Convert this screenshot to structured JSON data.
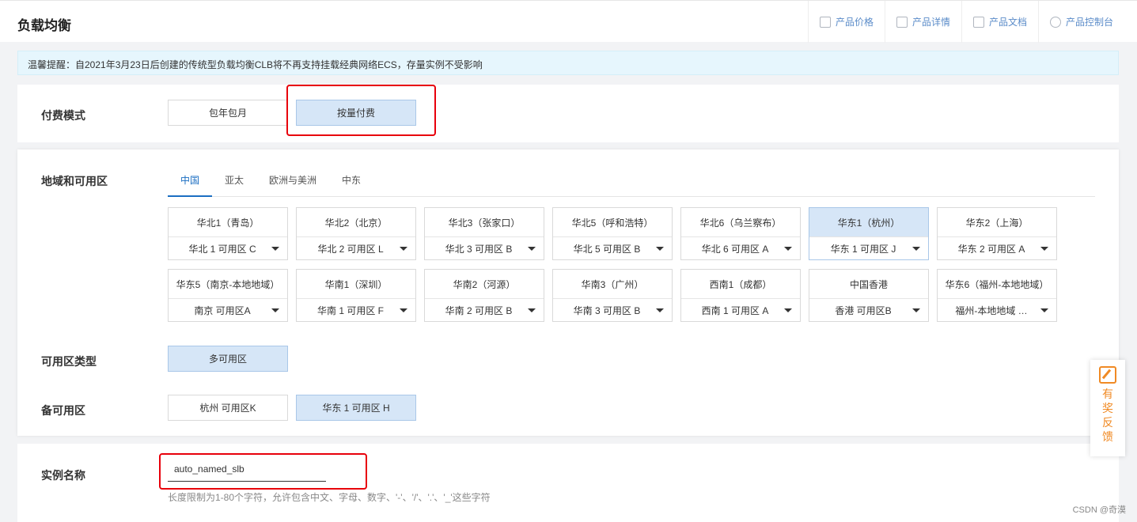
{
  "header": {
    "title": "负载均衡",
    "links": [
      {
        "label": "产品价格",
        "icon": "document-icon"
      },
      {
        "label": "产品详情",
        "icon": "list-icon"
      },
      {
        "label": "产品文档",
        "icon": "doc-icon"
      },
      {
        "label": "产品控制台",
        "icon": "gear-icon"
      }
    ]
  },
  "notice": "温馨提醒：自2021年3月23日后创建的传统型负载均衡CLB将不再支持挂载经典网络ECS，存量实例不受影响",
  "billing": {
    "label": "付费模式",
    "options": [
      "包年包月",
      "按量付费"
    ],
    "selected": "按量付费"
  },
  "region": {
    "label": "地域和可用区",
    "tabs": [
      "中国",
      "亚太",
      "欧洲与美洲",
      "中东"
    ],
    "active_tab": "中国",
    "regions": [
      {
        "name": "华北1（青岛）",
        "zone": "华北 1 可用区 C",
        "selected": false
      },
      {
        "name": "华北2（北京）",
        "zone": "华北 2 可用区 L",
        "selected": false
      },
      {
        "name": "华北3（张家口）",
        "zone": "华北 3 可用区 B",
        "selected": false
      },
      {
        "name": "华北5（呼和浩特）",
        "zone": "华北 5 可用区 B",
        "selected": false
      },
      {
        "name": "华北6（乌兰察布）",
        "zone": "华北 6 可用区 A",
        "selected": false
      },
      {
        "name": "华东1（杭州）",
        "zone": "华东 1 可用区 J",
        "selected": true
      },
      {
        "name": "华东2（上海）",
        "zone": "华东 2 可用区 A",
        "selected": false
      },
      {
        "name": "华东5（南京-本地地域）",
        "zone": "南京 可用区A",
        "selected": false
      },
      {
        "name": "华南1（深圳）",
        "zone": "华南 1 可用区 F",
        "selected": false
      },
      {
        "name": "华南2（河源）",
        "zone": "华南 2 可用区 B",
        "selected": false
      },
      {
        "name": "华南3（广州）",
        "zone": "华南 3 可用区 B",
        "selected": false
      },
      {
        "name": "西南1（成都）",
        "zone": "西南 1 可用区 A",
        "selected": false
      },
      {
        "name": "中国香港",
        "zone": "香港 可用区B",
        "selected": false
      },
      {
        "name": "华东6（福州-本地地域）",
        "zone": "福州-本地地域 …",
        "selected": false
      }
    ]
  },
  "zone_type": {
    "label": "可用区类型",
    "options": [
      "多可用区"
    ],
    "selected": "多可用区"
  },
  "backup_zone": {
    "label": "备可用区",
    "options": [
      "杭州 可用区K",
      "华东 1 可用区 H"
    ],
    "selected": "华东 1 可用区 H"
  },
  "instance_name": {
    "label": "实例名称",
    "value": "auto_named_slb",
    "hint": "长度限制为1-80个字符，允许包含中文、字母、数字、'-'、'/'、'.'、'_'这些字符"
  },
  "feedback": {
    "label": "有奖反馈",
    "icon": "edit-icon"
  },
  "watermark": "CSDN @奇漠",
  "colors": {
    "accent": "#1b6ec2",
    "selected_bg": "#d6e6f7",
    "highlight": "#e8000b",
    "feedback": "#f08a24"
  }
}
